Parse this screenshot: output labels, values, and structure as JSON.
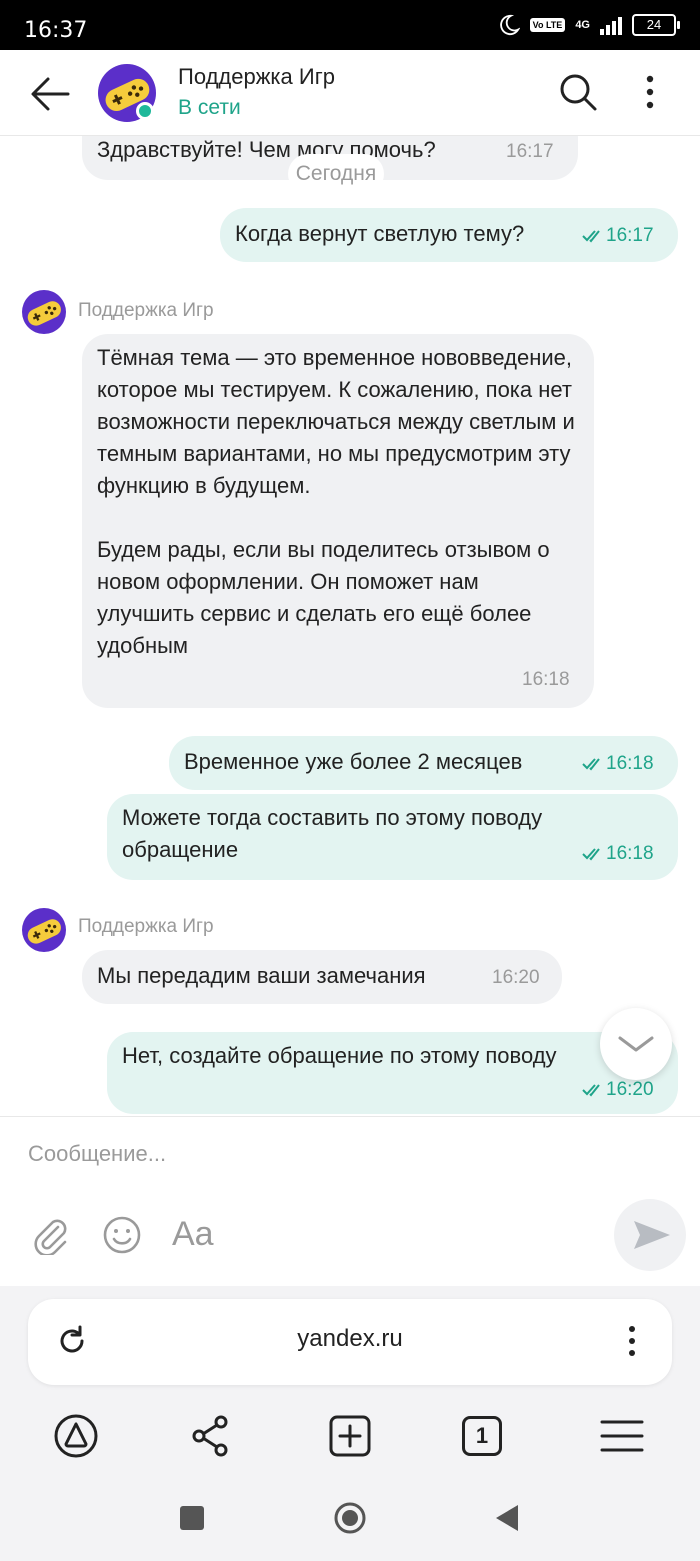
{
  "status_bar": {
    "time": "16:37",
    "network": "4G",
    "volte": "Vo LTE",
    "battery": "24"
  },
  "header": {
    "title": "Поддержка Игр",
    "status": "В сети"
  },
  "chat": {
    "date_separator": "Сегодня",
    "messages": [
      {
        "direction": "in",
        "text": "Здравствуйте! Чем могу помочь?",
        "time": "16:17"
      },
      {
        "direction": "out",
        "text": "Когда вернут светлую тему?",
        "time": "16:17"
      },
      {
        "direction": "in",
        "sender": "Поддержка Игр",
        "text": "Тёмная тема — это временное нововведение, которое мы тестируем. К сожалению, пока нет возможности переключаться между светлым и темным вариантами, но мы предусмотрим эту функцию в будущем.\n\nБудем рады, если вы поделитесь отзывом о новом оформлении. Он поможет нам улучшить сервис и сделать его ещё более удобным",
        "time": "16:18"
      },
      {
        "direction": "out",
        "text": "Временное уже более 2 месяцев",
        "time": "16:18"
      },
      {
        "direction": "out",
        "text": "Можете тогда составить по этому поводу обращение",
        "time": "16:18"
      },
      {
        "direction": "in",
        "sender": "Поддержка Игр",
        "text": "Мы передадим ваши замечания",
        "time": "16:20"
      },
      {
        "direction": "out",
        "text": "Нет, создайте обращение по этому поводу",
        "time": "16:20"
      }
    ]
  },
  "composer": {
    "placeholder": "Сообщение...",
    "format_label": "Aa"
  },
  "browser": {
    "url": "yandex.ru",
    "tabs_count": "1"
  },
  "colors": {
    "accent": "#1fa48a",
    "incoming_bubble": "#f0f1f3",
    "outgoing_bubble": "#e3f4f1",
    "avatar_bg": "#5b2fc9",
    "avatar_fg": "#f5cc3c"
  }
}
